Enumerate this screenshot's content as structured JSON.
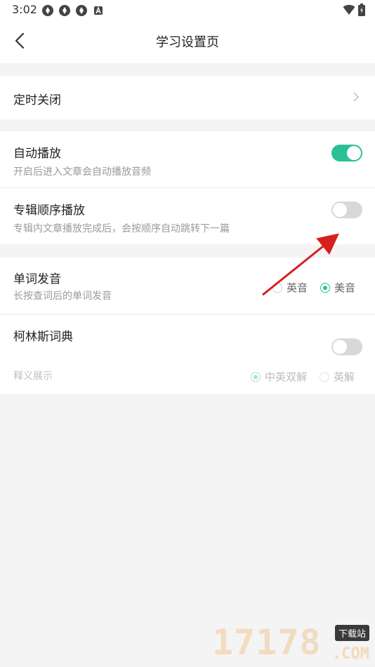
{
  "status_bar": {
    "time": "3:02",
    "icons": [
      "app-notification-icon",
      "app-notification-icon",
      "app-notification-icon",
      "a-icon"
    ],
    "right_icons": [
      "wifi-icon",
      "battery-charging-icon"
    ]
  },
  "header": {
    "title": "学习设置页"
  },
  "timer": {
    "label": "定时关闭"
  },
  "autoplay": {
    "label": "自动播放",
    "description": "开启后进入文章会自动播放音频",
    "enabled": true
  },
  "album_order": {
    "label": "专辑顺序播放",
    "description": "专辑内文章播放完成后，会按顺序自动跳转下一篇",
    "enabled": false
  },
  "pronunciation": {
    "label": "单词发音",
    "description": "长按查词后的单词发音",
    "options": [
      {
        "label": "英音",
        "selected": false
      },
      {
        "label": "美音",
        "selected": true
      }
    ]
  },
  "collins": {
    "label": "柯林斯词典",
    "enabled": false,
    "display_label": "释义展示",
    "options": [
      {
        "label": "中英双解",
        "selected": true
      },
      {
        "label": "英解",
        "selected": false
      }
    ]
  },
  "watermark": {
    "number": "17178",
    "badge": "下载站",
    "domain": ".COM"
  },
  "colors": {
    "accent": "#2bbf96",
    "annotation_arrow": "#d61f1f",
    "background": "#f4f4f4"
  }
}
